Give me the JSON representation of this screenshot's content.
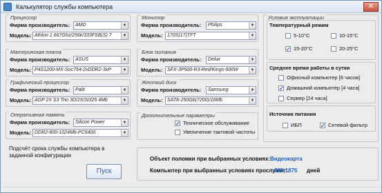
{
  "window": {
    "title": "Калькулятор службы компьютера"
  },
  "left": {
    "groups": [
      {
        "title": "Процессор",
        "maker_label": "Фирма производитель:",
        "maker_value": "AMD",
        "model_label": "Модель:",
        "model_value": "Athlon 1.667Ghz/256k/333FSB(S) 7"
      },
      {
        "title": "Материнская плата",
        "maker_label": "Фирма производитель:",
        "maker_value": "ASUS",
        "model_label": "Модель:",
        "model_value": "P4S1200-MX-Soc754-2xDDR2-3xP"
      },
      {
        "title": "Графический процессор",
        "maker_label": "Фирма производитель:",
        "maker_value": "Palit",
        "model_label": "Модель:",
        "model_value": "AGP 2X S3 Trio 3D/2X/Si325 4Mb"
      },
      {
        "title": "Оперативная память",
        "maker_label": "Фирма производитель:",
        "maker_value": "Silicon Power",
        "model_label": "Модель:",
        "model_value": "DDR2-800-1024Mb-PC6400"
      }
    ]
  },
  "middle": {
    "groups": [
      {
        "title": "Монитор",
        "maker_label": "Фирма производитель:",
        "maker_value": "Philips",
        "model_label": "Модель:",
        "model_value": "170S(17)TFT"
      },
      {
        "title": "Блок питания",
        "maker_label": "Фирма производитель:",
        "maker_value": "Delux",
        "model_label": "Модель:",
        "model_value": "SFX-3P500-R3-Red/Kings-500W"
      },
      {
        "title": "Жесткий диск",
        "maker_label": "Фирма производитель:",
        "maker_value": "Samsung",
        "model_label": "Модель:",
        "model_value": "SATA-250Gb(7200)/16Mb"
      }
    ],
    "extra": {
      "title": "Дополнительные параметры",
      "options": [
        {
          "label": "Техническое обслуживание",
          "checked": true
        },
        {
          "label": "Увеличение тактовой частоты",
          "checked": false
        }
      ]
    }
  },
  "right": {
    "conditions_title": "Условия эксплуатации",
    "temp_title": "Температурный режим",
    "temps": [
      {
        "label": "5-10°C",
        "checked": false
      },
      {
        "label": "10-15°C",
        "checked": false
      },
      {
        "label": "15-20°C",
        "checked": true
      },
      {
        "label": "20-25°C",
        "checked": false
      }
    ],
    "usage_title": "Среднее время работы в сутки",
    "usage": [
      {
        "label": "Офисный компьютер [8 часов]",
        "checked": false
      },
      {
        "label": "Домашний компьютер [4 часа]",
        "checked": true
      },
      {
        "label": "Сервер [24 часа]",
        "checked": false
      }
    ],
    "power_title": "Источник питания",
    "power": [
      {
        "label": "ИБП",
        "checked": false
      },
      {
        "label": "Сетевой фильтр",
        "checked": true
      }
    ]
  },
  "bottom": {
    "description": "Подсчёт срока службы компьютера в заданной конфигурации",
    "button_label": "Пуск",
    "weak_label": "Объект поломки при выбранных условиях:",
    "weak_value": "Видеокарта",
    "life_label": "Компьютер при выбранных условиях прослужит:",
    "life_value": "835,1875",
    "life_unit": "дней"
  }
}
